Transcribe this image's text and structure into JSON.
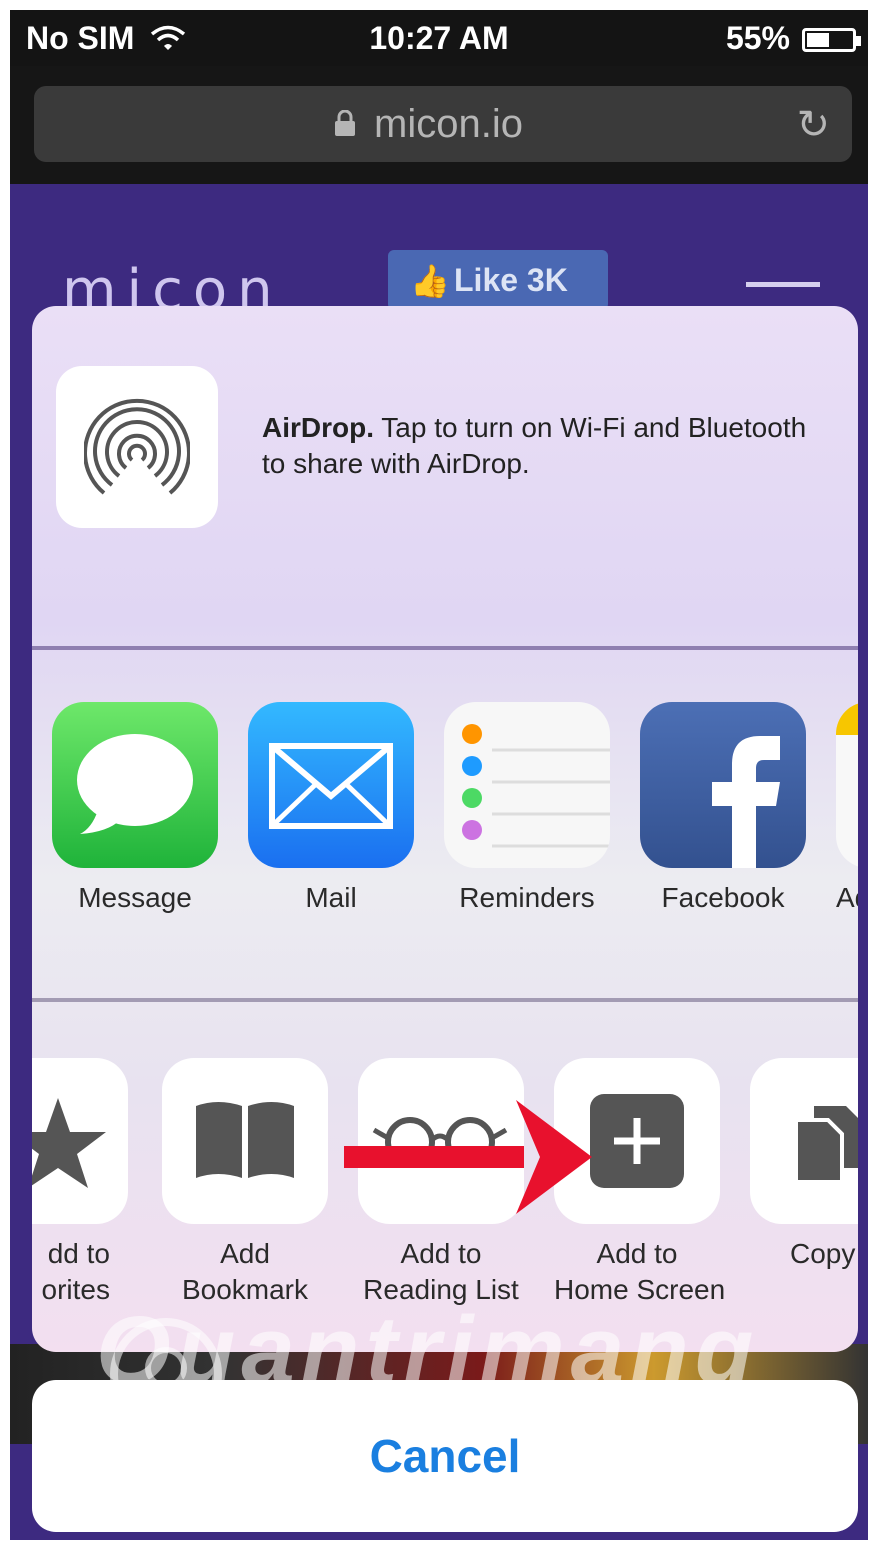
{
  "status_bar": {
    "carrier": "No SIM",
    "time": "10:27 AM",
    "battery_percent": "55%",
    "battery_level": 0.55
  },
  "address_bar": {
    "url": "micon.io",
    "icons": [
      "lock-icon",
      "reload-icon"
    ]
  },
  "website": {
    "logo": "micon",
    "like_button": "Like 3K"
  },
  "airdrop": {
    "title": "AirDrop.",
    "message": "Tap to turn on Wi-Fi and Bluetooth to share with AirDrop."
  },
  "share_apps": [
    {
      "label": "Message",
      "icon": "message-icon",
      "color": "#34c84a"
    },
    {
      "label": "Mail",
      "icon": "mail-icon",
      "color": "#1e8ef5"
    },
    {
      "label": "Reminders",
      "icon": "reminders-icon",
      "color": "#ffffff"
    },
    {
      "label": "Facebook",
      "icon": "facebook-icon",
      "color": "#3b5998"
    },
    {
      "label": "Ad",
      "icon": "notes-icon",
      "color": "#f5c600"
    }
  ],
  "actions": [
    {
      "label_line1": "dd to",
      "label_line2": "orites",
      "icon": "star-icon"
    },
    {
      "label_line1": "Add",
      "label_line2": "Bookmark",
      "icon": "book-icon"
    },
    {
      "label_line1": "Add to",
      "label_line2": "Reading List",
      "icon": "glasses-icon"
    },
    {
      "label_line1": "Add to",
      "label_line2": "Home Screen",
      "icon": "add-home-icon"
    },
    {
      "label_line1": "Copy",
      "label_line2": "",
      "icon": "copy-icon"
    }
  ],
  "cancel_label": "Cancel",
  "watermark": "Quantrimang",
  "annotation": {
    "arrow_color": "#e8112d"
  }
}
